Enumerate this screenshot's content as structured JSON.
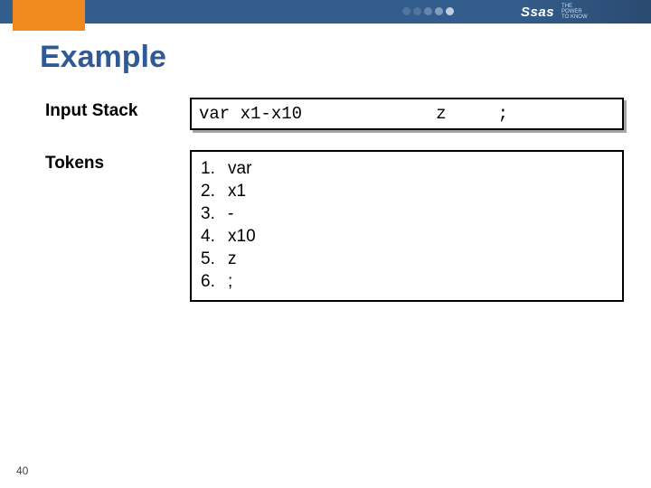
{
  "header": {
    "logo": "Ssas",
    "tagline1": "THE",
    "tagline2": "POWER",
    "tagline3": "TO KNOW"
  },
  "slide": {
    "title": "Example",
    "number": "40"
  },
  "input_stack": {
    "label": "Input Stack",
    "code": "var x1-x10             z     ;"
  },
  "tokens": {
    "label": "Tokens",
    "items": [
      {
        "n": "1.",
        "v": "var"
      },
      {
        "n": "2.",
        "v": "x1"
      },
      {
        "n": "3.",
        "v": "-"
      },
      {
        "n": "4.",
        "v": "x10"
      },
      {
        "n": "5.",
        "v": "z"
      },
      {
        "n": "6.",
        "v": ";"
      }
    ]
  }
}
